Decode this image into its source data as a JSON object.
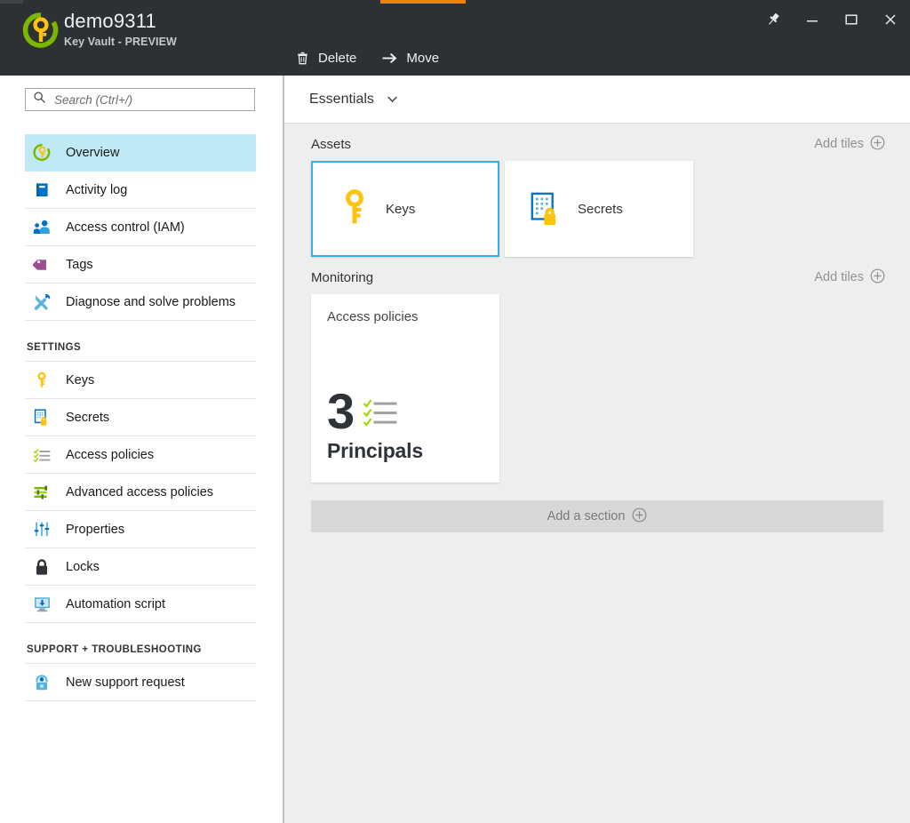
{
  "window": {
    "title": "demo9311",
    "subtitle": "Key Vault - PREVIEW",
    "accent_color": "#f0820b",
    "titlebar_color": "#2d3134",
    "controls": [
      {
        "name": "pin-icon",
        "label": "Pin"
      },
      {
        "name": "minimize-icon",
        "label": "Minimize"
      },
      {
        "name": "maximize-icon",
        "label": "Maximize"
      },
      {
        "name": "close-icon",
        "label": "Close"
      }
    ]
  },
  "toolbar": {
    "delete_label": "Delete",
    "move_label": "Move"
  },
  "search": {
    "placeholder": "Search (Ctrl+/)",
    "value": ""
  },
  "sidebar": {
    "items": [
      {
        "label": "Overview",
        "icon": "key-circle-icon",
        "selected": true
      },
      {
        "label": "Activity log",
        "icon": "book-icon",
        "selected": false
      },
      {
        "label": "Access control (IAM)",
        "icon": "people-icon",
        "selected": false
      },
      {
        "label": "Tags",
        "icon": "tag-icon",
        "selected": false
      },
      {
        "label": "Diagnose and solve problems",
        "icon": "tools-icon",
        "selected": false
      }
    ],
    "groups": [
      {
        "title": "SETTINGS",
        "items": [
          {
            "label": "Keys",
            "icon": "key-icon"
          },
          {
            "label": "Secrets",
            "icon": "secrets-lock-icon"
          },
          {
            "label": "Access policies",
            "icon": "checklist-icon"
          },
          {
            "label": "Advanced access policies",
            "icon": "sliders-green-icon"
          },
          {
            "label": "Properties",
            "icon": "sliders-blue-icon"
          },
          {
            "label": "Locks",
            "icon": "padlock-icon"
          },
          {
            "label": "Automation script",
            "icon": "monitor-download-icon"
          }
        ]
      },
      {
        "title": "SUPPORT + TROUBLESHOOTING",
        "items": [
          {
            "label": "New support request",
            "icon": "support-headset-icon"
          }
        ]
      }
    ]
  },
  "main": {
    "essentials_label": "Essentials",
    "add_tiles_label": "Add tiles",
    "add_section_label": "Add a section",
    "sections": [
      {
        "title": "Assets",
        "tiles": [
          {
            "label": "Keys",
            "icon": "key-icon",
            "selected": true
          },
          {
            "label": "Secrets",
            "icon": "secrets-lock-icon",
            "selected": false
          }
        ]
      },
      {
        "title": "Monitoring",
        "tiles": [
          {
            "title": "Access policies",
            "value": "3",
            "unit": "Principals",
            "icon": "checklist-icon"
          }
        ]
      }
    ]
  }
}
